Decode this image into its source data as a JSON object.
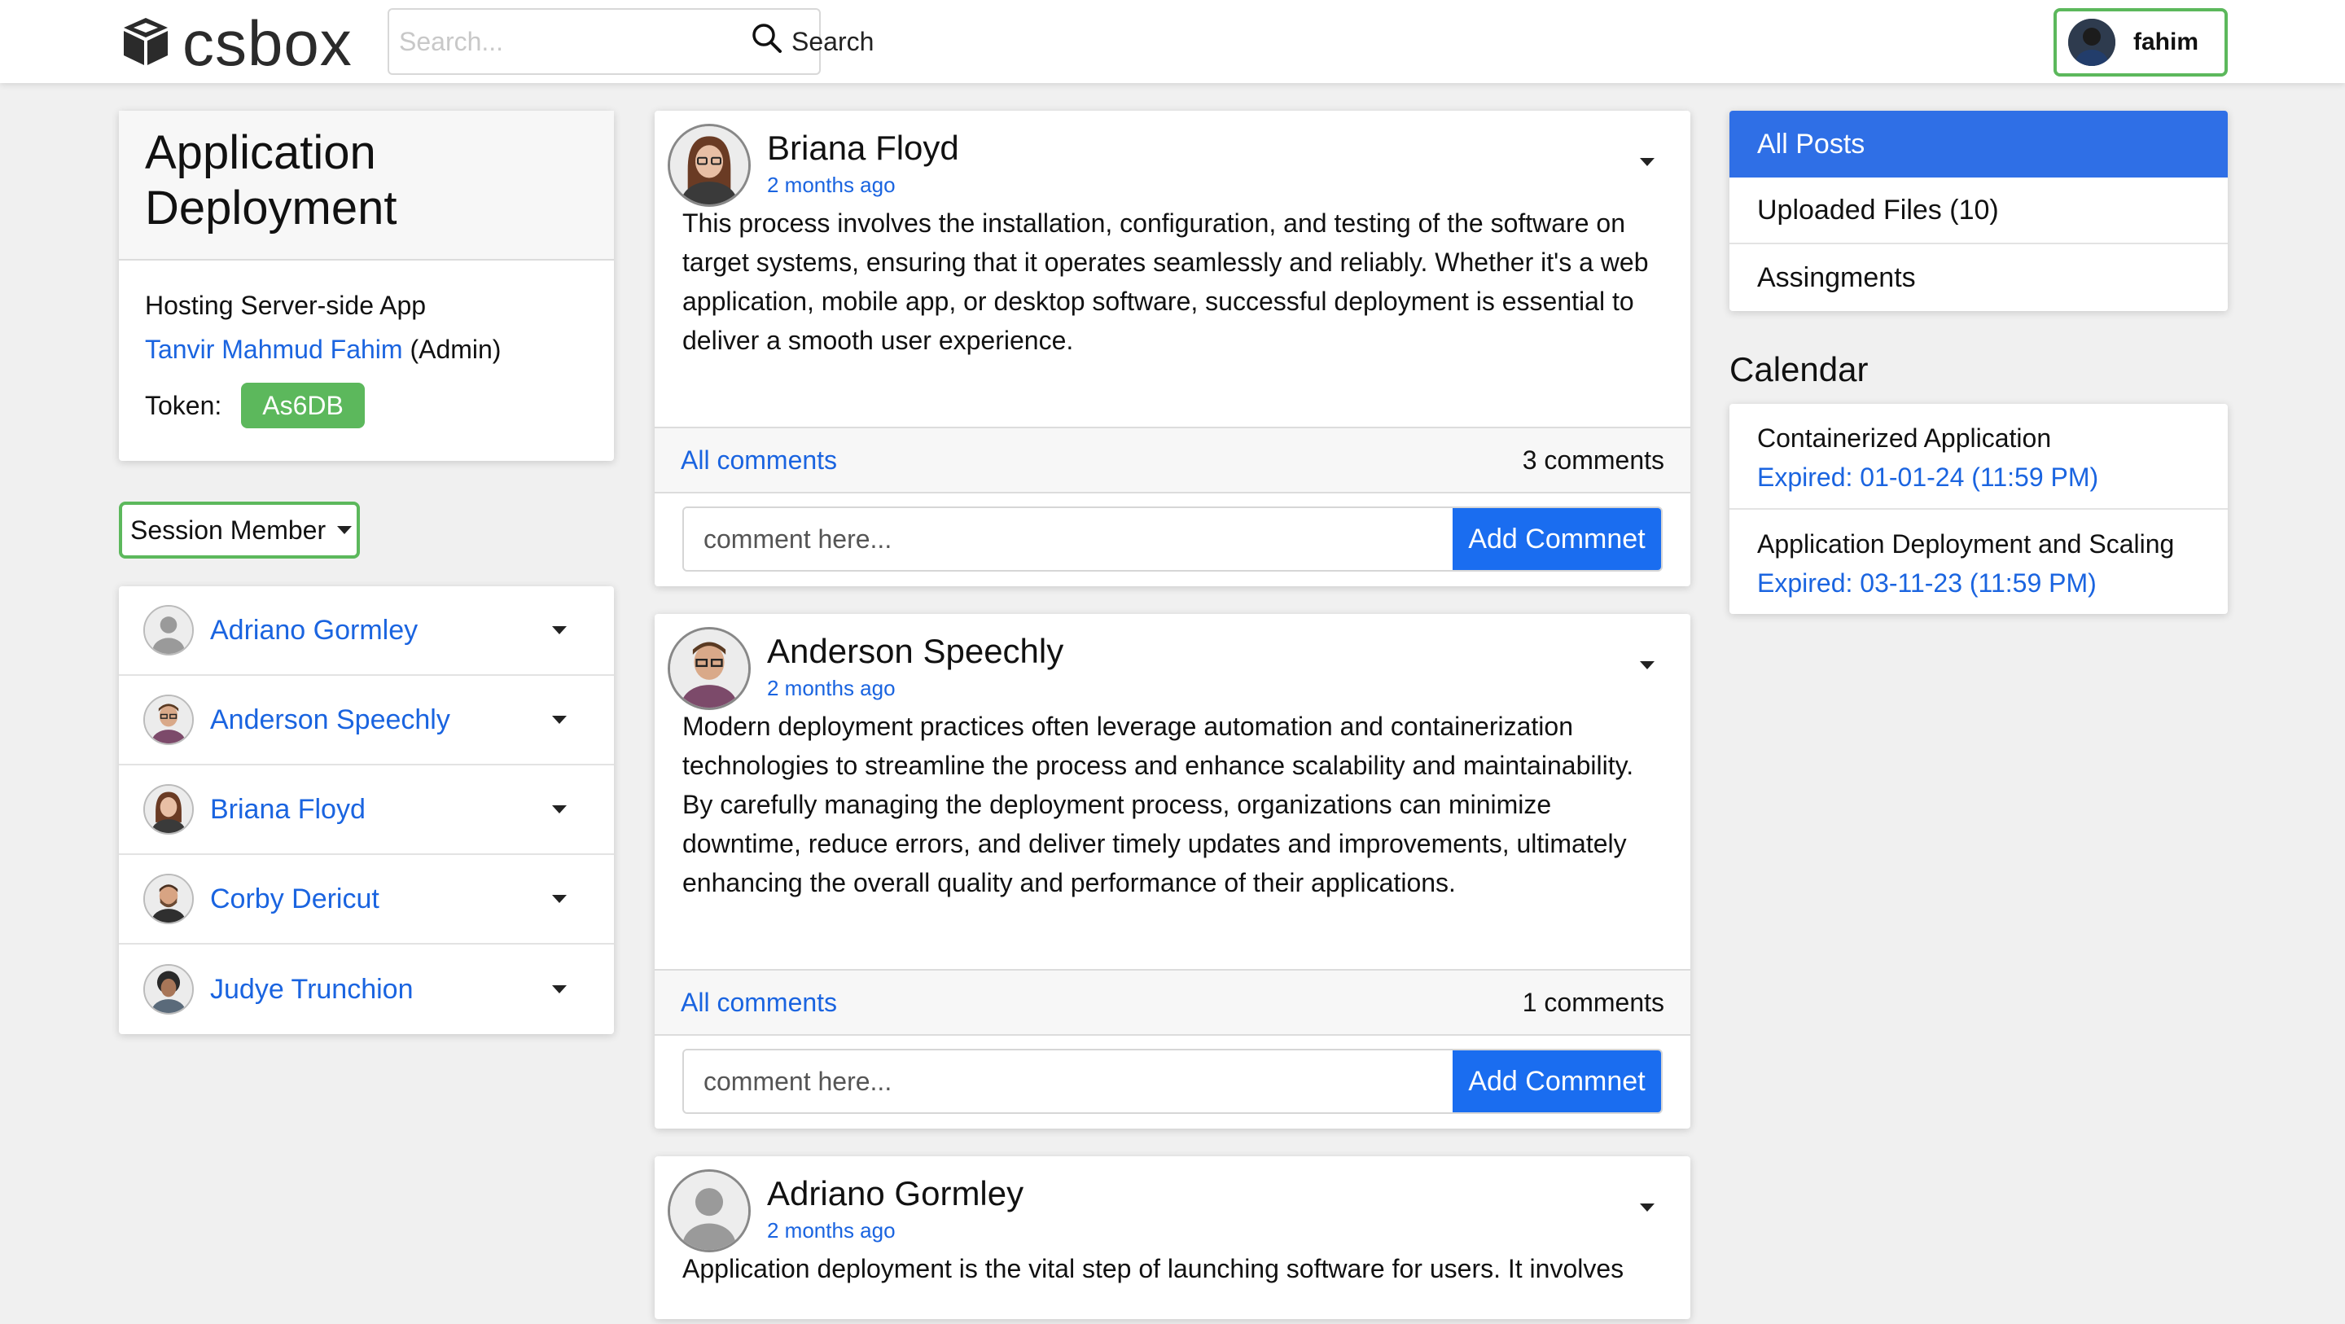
{
  "header": {
    "logo_text": "csbox",
    "search_placeholder": "Search...",
    "search_label": "Search",
    "username": "fahim"
  },
  "session": {
    "title": "Application Deployment",
    "subtitle": "Hosting Server-side App",
    "owner_name": "Tanvir Mahmud Fahim",
    "owner_role": "(Admin)",
    "token_label": "Token:",
    "token_value": "As6DB"
  },
  "members": {
    "dropdown_label": "Session Member",
    "items": [
      {
        "name": "Adriano Gormley",
        "avatar": "placeholder"
      },
      {
        "name": "Anderson Speechly",
        "avatar": "man-glasses"
      },
      {
        "name": "Briana Floyd",
        "avatar": "woman-glasses"
      },
      {
        "name": "Corby Dericut",
        "avatar": "man-beard"
      },
      {
        "name": "Judye Trunchion",
        "avatar": "woman-curly"
      }
    ]
  },
  "posts": [
    {
      "author": "Briana Floyd",
      "time": "2 months ago",
      "body": "This process involves the installation, configuration, and testing of the software on target systems, ensuring that it operates seamlessly and reliably. Whether it's a web application, mobile app, or desktop software, successful deployment is essential to deliver a smooth user experience.",
      "all_comments_label": "All comments",
      "comment_count": "3 comments",
      "comment_placeholder": "comment here...",
      "add_button": "Add Commnet"
    },
    {
      "author": "Anderson Speechly",
      "time": "2 months ago",
      "body": "Modern deployment practices often leverage automation and containerization technologies to streamline the process and enhance scalability and maintainability. By carefully managing the deployment process, organizations can minimize downtime, reduce errors, and deliver timely updates and improvements, ultimately enhancing the overall quality and performance of their applications.",
      "all_comments_label": "All comments",
      "comment_count": "1 comments",
      "comment_placeholder": "comment here...",
      "add_button": "Add Commnet"
    },
    {
      "author": "Adriano Gormley",
      "time": "2 months ago",
      "body": "Application deployment is the vital step of launching software for users. It involves"
    }
  ],
  "tabs": [
    {
      "label": "All Posts",
      "active": true
    },
    {
      "label": "Uploaded Files (10)",
      "active": false
    },
    {
      "label": "Assingments",
      "active": false
    }
  ],
  "calendar": {
    "title": "Calendar",
    "items": [
      {
        "name": "Containerized Application",
        "expiry": "Expired: 01-01-24 (11:59 PM)"
      },
      {
        "name": "Application Deployment and Scaling",
        "expiry": "Expired: 03-11-23 (11:59 PM)"
      }
    ]
  },
  "colors": {
    "accent_blue": "#1a6df0",
    "link_blue": "#1a64e0",
    "success_green": "#5cb85c",
    "background": "#f0f0f0"
  }
}
